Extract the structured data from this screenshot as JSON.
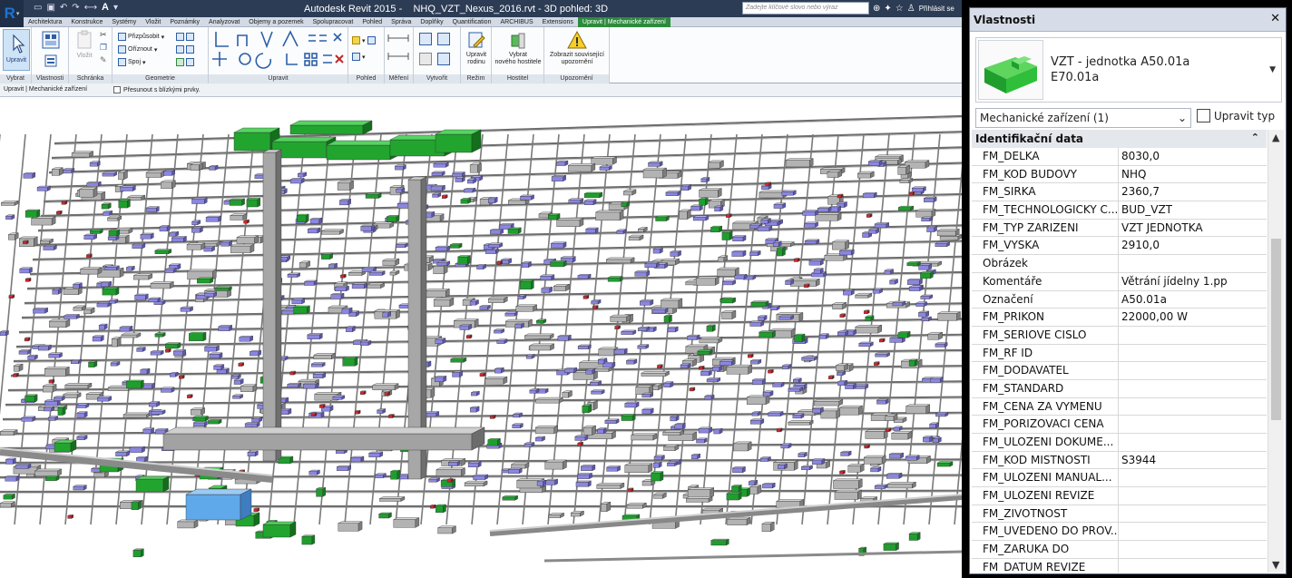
{
  "window": {
    "title": "Autodesk Revit 2015 -    NHQ_VZT_Nexus_2016.rvt - 3D pohled: 3D",
    "search_placeholder": "Zadejte klíčové slovo nebo výraz",
    "signin": "Přihlásit se"
  },
  "tabs": [
    "Architektura",
    "Konstrukce",
    "Systémy",
    "Vložit",
    "Poznámky",
    "Analyzovat",
    "Objemy a pozemek",
    "Spolupracovat",
    "Pohled",
    "Správa",
    "Doplňky",
    "Quantification",
    "ARCHIBUS",
    "Extensions",
    "Upravit | Mechanické zařízení"
  ],
  "active_tab": "Upravit | Mechanické zařízení",
  "ribbon": {
    "upravit": "Upravit",
    "schranka": {
      "paste": "Vložit"
    },
    "geometrie": {
      "fit": "Přizpůsobit",
      "cut": "Oříznout",
      "join": "Spoj"
    },
    "rodina": {
      "line1": "Upravit",
      "line2": "rodinu"
    },
    "hostitel": {
      "line1": "Vybrat",
      "line2": "nového hostitele"
    },
    "upozorneni": {
      "line1": "Zobrazit související",
      "line2": "upozornění"
    },
    "panels": [
      "Vybrat",
      "Vlastnosti",
      "Schránka",
      "Geometrie",
      "Upravit",
      "Pohled",
      "Měření",
      "Vytvořit",
      "Režim",
      "Hostitel",
      "Upozornění"
    ]
  },
  "options_bar": {
    "context": "Upravit | Mechanické zařízení",
    "checkbox": "Přesunout s blízkými prvky."
  },
  "properties": {
    "title": "Vlastnosti",
    "type_line1": "VZT - jednotka A50.01a",
    "type_line2": "E70.01a",
    "filter": "Mechanické zařízení (1)",
    "edit_type": "Upravit typ",
    "group": "Identifikační data",
    "rows": [
      {
        "k": "FM_DELKA",
        "v": "8030,0"
      },
      {
        "k": "FM_KOD BUDOVY",
        "v": "NHQ"
      },
      {
        "k": "FM_SIRKA",
        "v": "2360,7"
      },
      {
        "k": "FM_TECHNOLOGICKY C...",
        "v": "BUD_VZT"
      },
      {
        "k": "FM_TYP ZARIZENI",
        "v": "VZT JEDNOTKA"
      },
      {
        "k": "FM_VYSKA",
        "v": "2910,0"
      },
      {
        "k": "Obrázek",
        "v": ""
      },
      {
        "k": "Komentáře",
        "v": "Větrání jídelny 1.pp"
      },
      {
        "k": "Označení",
        "v": "A50.01a"
      },
      {
        "k": "FM_PRIKON",
        "v": "22000,00 W"
      },
      {
        "k": "FM_SERIOVE CISLO",
        "v": ""
      },
      {
        "k": "FM_RF ID",
        "v": ""
      },
      {
        "k": "FM_DODAVATEL",
        "v": ""
      },
      {
        "k": "FM_STANDARD",
        "v": ""
      },
      {
        "k": "FM_CENA ZA VYMENU",
        "v": ""
      },
      {
        "k": "FM_PORIZOVACI CENA",
        "v": ""
      },
      {
        "k": "FM_ULOZENI DOKUME...",
        "v": ""
      },
      {
        "k": "FM_KOD MISTNOSTI",
        "v": "S3944"
      },
      {
        "k": "FM_ULOZENI MANUAL...",
        "v": ""
      },
      {
        "k": "FM_ULOZENI REVIZE",
        "v": ""
      },
      {
        "k": "FM_ZIVOTNOST",
        "v": ""
      },
      {
        "k": "FM_UVEDENO DO PROV...",
        "v": ""
      },
      {
        "k": "FM_ZARUKA DO",
        "v": ""
      },
      {
        "k": "FM_DATUM REVIZE",
        "v": ""
      }
    ]
  },
  "colors": {
    "titlebar": "#2c3c55",
    "context_tab": "#2d8b3e",
    "duct_gray": "#a9a9a9",
    "equipment_green": "#1f9e2e",
    "terminal_blue": "#8b86e0",
    "selected_blue": "#5fa8ea"
  }
}
